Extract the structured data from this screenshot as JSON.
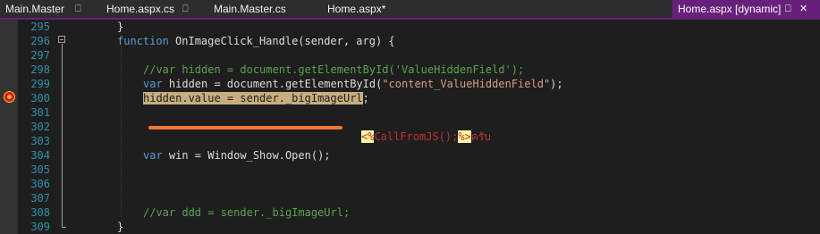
{
  "tabs": [
    {
      "label": "Main.Master",
      "pin": "⎕",
      "active": false
    },
    {
      "label": "Home.aspx.cs",
      "pin": "⎕",
      "active": false
    },
    {
      "label": "Main.Master.cs",
      "active": false
    },
    {
      "label": "Home.aspx*",
      "active": false
    },
    {
      "label": "Home.aspx [dynamic]",
      "pin": "⎕",
      "close": "✕",
      "active": true
    }
  ],
  "editor": {
    "line_numbers": [
      "295",
      "296",
      "297",
      "298",
      "299",
      "300",
      "301",
      "302",
      "303",
      "304",
      "305",
      "306",
      "307",
      "308",
      "309"
    ],
    "lines": {
      "l295": "}",
      "l296_kw": "function",
      "l296_rest": " OnImageClick_Handle(sender, arg) {",
      "l298": "//var hidden = document.getElementById('ValueHiddenField');",
      "l299_kw": "var",
      "l299_mid": " hidden = document.getElementById(",
      "l299_str": "\"content_ValueHiddenField\"",
      "l299_end": ");",
      "l300": "hidden.value = sender._bigImageUrl",
      "l300_end": ";",
      "l304_kw": "var",
      "l304_rest": " win = Window_Show.Open();",
      "l308": "//var ddd = sender._bigImageUrl;",
      "l309": "}"
    },
    "inline_asp": {
      "open": "<%",
      "body": "CallFromJS();",
      "close": "%>",
      "after": "ครับ"
    }
  },
  "colors": {
    "accent_tab": "#68217a",
    "line_number": "#2b91af",
    "keyword": "#569cd6",
    "string": "#d69d85",
    "comment": "#57a64a",
    "highlight": "#c8ad7f",
    "annotation_bar": "#f07a28"
  }
}
